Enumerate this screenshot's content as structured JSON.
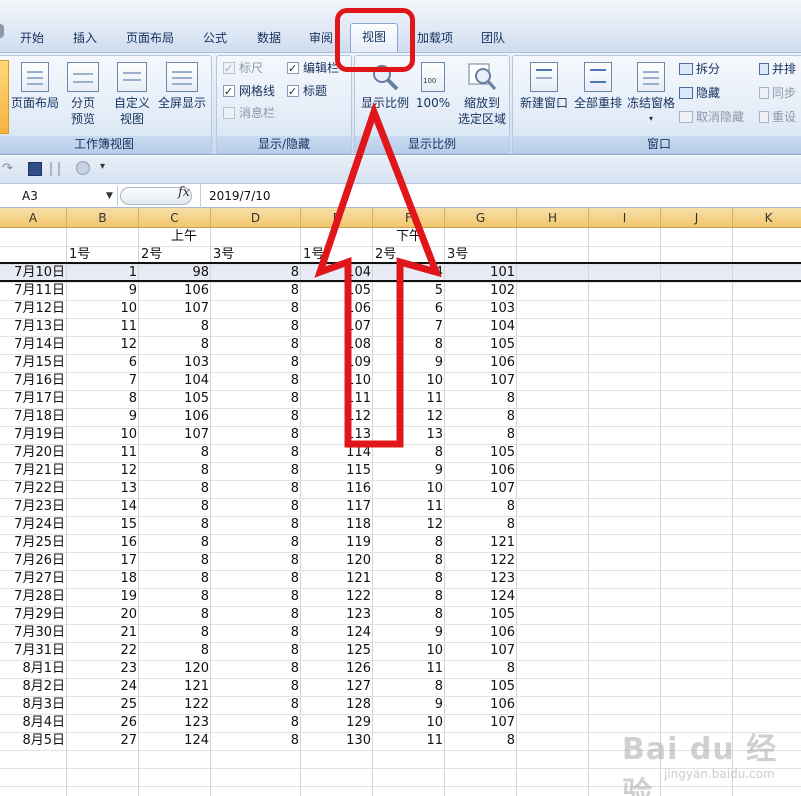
{
  "ribbon_tabs": [
    "开始",
    "插入",
    "页面布局",
    "公式",
    "数据",
    "审阅",
    "视图",
    "加载项",
    "团队"
  ],
  "active_tab": "视图",
  "groups": {
    "workbook_views": {
      "label": "工作簿视图",
      "page_layout": "页面布局",
      "page_break_preview_1": "分页",
      "page_break_preview_2": "预览",
      "custom_views_1": "自定义",
      "custom_views_2": "视图",
      "full_screen": "全屏显示"
    },
    "show_hide": {
      "label": "显示/隐藏",
      "ruler": "标尺",
      "gridlines": "网格线",
      "message_bar": "消息栏",
      "formula_bar": "编辑栏",
      "headings": "标题"
    },
    "zoom": {
      "label": "显示比例",
      "zoom": "显示比例",
      "zoom_100": "100%",
      "zoom_selection_1": "缩放到",
      "zoom_selection_2": "选定区域",
      "page_icon_text": "100"
    },
    "window": {
      "label": "窗口",
      "new_window": "新建窗口",
      "arrange_all": "全部重排",
      "freeze_panes": "冻结窗格",
      "split": "拆分",
      "hide": "隐藏",
      "unhide": "取消隐藏",
      "side_by_side": "并排",
      "sync_scroll": "同步",
      "reset_position": "重设"
    }
  },
  "formula_bar": {
    "name_box": "A3",
    "fx": "fx",
    "content": "2019/7/10"
  },
  "columns": [
    "A",
    "B",
    "C",
    "D",
    "E",
    "F",
    "G",
    "H",
    "I",
    "J",
    "K"
  ],
  "header_rows": {
    "morning": "上午",
    "afternoon": "下午",
    "labels": [
      "1号",
      "2号",
      "3号",
      "1号",
      "2号",
      "3号"
    ]
  },
  "rows": [
    [
      "7月10日",
      "1",
      "98",
      "8",
      "104",
      "4",
      "101"
    ],
    [
      "7月11日",
      "9",
      "106",
      "8",
      "105",
      "5",
      "102"
    ],
    [
      "7月12日",
      "10",
      "107",
      "8",
      "106",
      "6",
      "103"
    ],
    [
      "7月13日",
      "11",
      "8",
      "8",
      "107",
      "7",
      "104"
    ],
    [
      "7月14日",
      "12",
      "8",
      "8",
      "108",
      "8",
      "105"
    ],
    [
      "7月15日",
      "6",
      "103",
      "8",
      "109",
      "9",
      "106"
    ],
    [
      "7月16日",
      "7",
      "104",
      "8",
      "110",
      "10",
      "107"
    ],
    [
      "7月17日",
      "8",
      "105",
      "8",
      "111",
      "11",
      "8"
    ],
    [
      "7月18日",
      "9",
      "106",
      "8",
      "112",
      "12",
      "8"
    ],
    [
      "7月19日",
      "10",
      "107",
      "8",
      "113",
      "13",
      "8"
    ],
    [
      "7月20日",
      "11",
      "8",
      "8",
      "114",
      "8",
      "105"
    ],
    [
      "7月21日",
      "12",
      "8",
      "8",
      "115",
      "9",
      "106"
    ],
    [
      "7月22日",
      "13",
      "8",
      "8",
      "116",
      "10",
      "107"
    ],
    [
      "7月23日",
      "14",
      "8",
      "8",
      "117",
      "11",
      "8"
    ],
    [
      "7月24日",
      "15",
      "8",
      "8",
      "118",
      "12",
      "8"
    ],
    [
      "7月25日",
      "16",
      "8",
      "8",
      "119",
      "8",
      "121"
    ],
    [
      "7月26日",
      "17",
      "8",
      "8",
      "120",
      "8",
      "122"
    ],
    [
      "7月27日",
      "18",
      "8",
      "8",
      "121",
      "8",
      "123"
    ],
    [
      "7月28日",
      "19",
      "8",
      "8",
      "122",
      "8",
      "124"
    ],
    [
      "7月29日",
      "20",
      "8",
      "8",
      "123",
      "8",
      "105"
    ],
    [
      "7月30日",
      "21",
      "8",
      "8",
      "124",
      "9",
      "106"
    ],
    [
      "7月31日",
      "22",
      "8",
      "8",
      "125",
      "10",
      "107"
    ],
    [
      "8月1日",
      "23",
      "120",
      "8",
      "126",
      "11",
      "8"
    ],
    [
      "8月2日",
      "24",
      "121",
      "8",
      "127",
      "8",
      "105"
    ],
    [
      "8月3日",
      "25",
      "122",
      "8",
      "128",
      "9",
      "106"
    ],
    [
      "8月4日",
      "26",
      "123",
      "8",
      "129",
      "10",
      "107"
    ],
    [
      "8月5日",
      "27",
      "124",
      "8",
      "130",
      "11",
      "8"
    ]
  ],
  "watermark": {
    "main": "Bai du 经验",
    "sub": "jingyan.baidu.com"
  },
  "colors": {
    "annotation_red": "#e0161b",
    "column_header": "#f2c66c",
    "ribbon_bg": "#dae5f3"
  }
}
